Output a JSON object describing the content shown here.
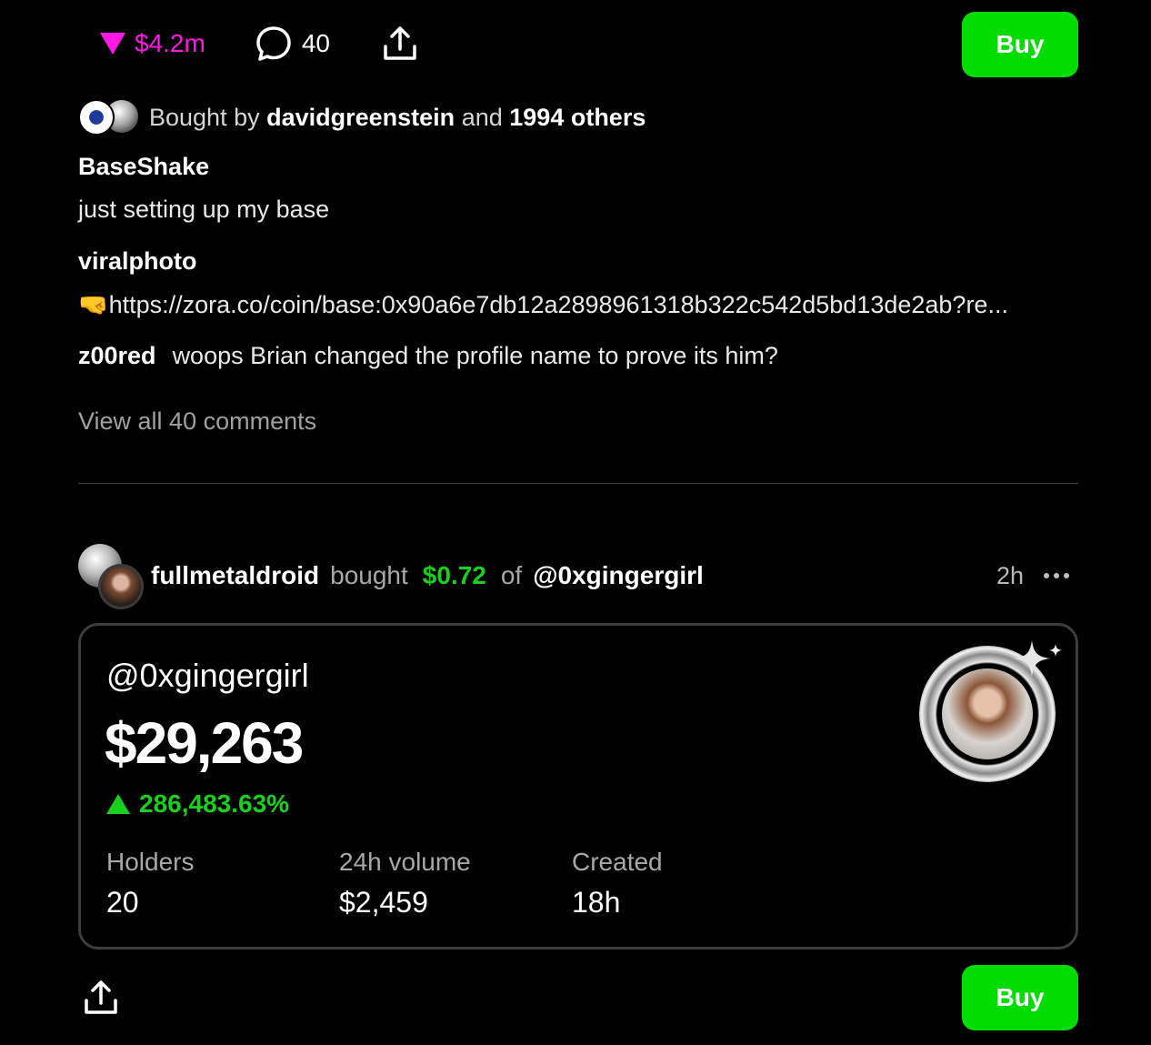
{
  "top_actions": {
    "market_cap": "$4.2m",
    "comment_count": "40",
    "buy_label": "Buy"
  },
  "bought_by": {
    "prefix": "Bought by",
    "user": "davidgreenstein",
    "joiner": "and",
    "others": "1994 others"
  },
  "comments": [
    {
      "author": "BaseShake",
      "text": "just setting up my base"
    },
    {
      "author": "viralphoto",
      "text": "🤜https://zora.co/coin/base:0x90a6e7db12a2898961318b322c542d5bd13de2ab?re..."
    },
    {
      "author": "z00red",
      "text": "woops Brian changed the profile name to prove its him?"
    }
  ],
  "view_all": "View all 40 comments",
  "activity": {
    "user": "fullmetaldroid",
    "verb": "bought",
    "amount": "$0.72",
    "of": "of",
    "target": "@0xgingergirl",
    "time": "2h"
  },
  "coin_card": {
    "handle": "@0xgingergirl",
    "price": "$29,263",
    "change": "286,483.63%",
    "stats": [
      {
        "label": "Holders",
        "value": "20"
      },
      {
        "label": "24h volume",
        "value": "$2,459"
      },
      {
        "label": "Created",
        "value": "18h"
      }
    ]
  },
  "bottom_actions": {
    "buy_label": "Buy"
  },
  "colors": {
    "accent_green": "#00dc00",
    "price_pink": "#ff19e4",
    "up_green": "#19d01c"
  }
}
